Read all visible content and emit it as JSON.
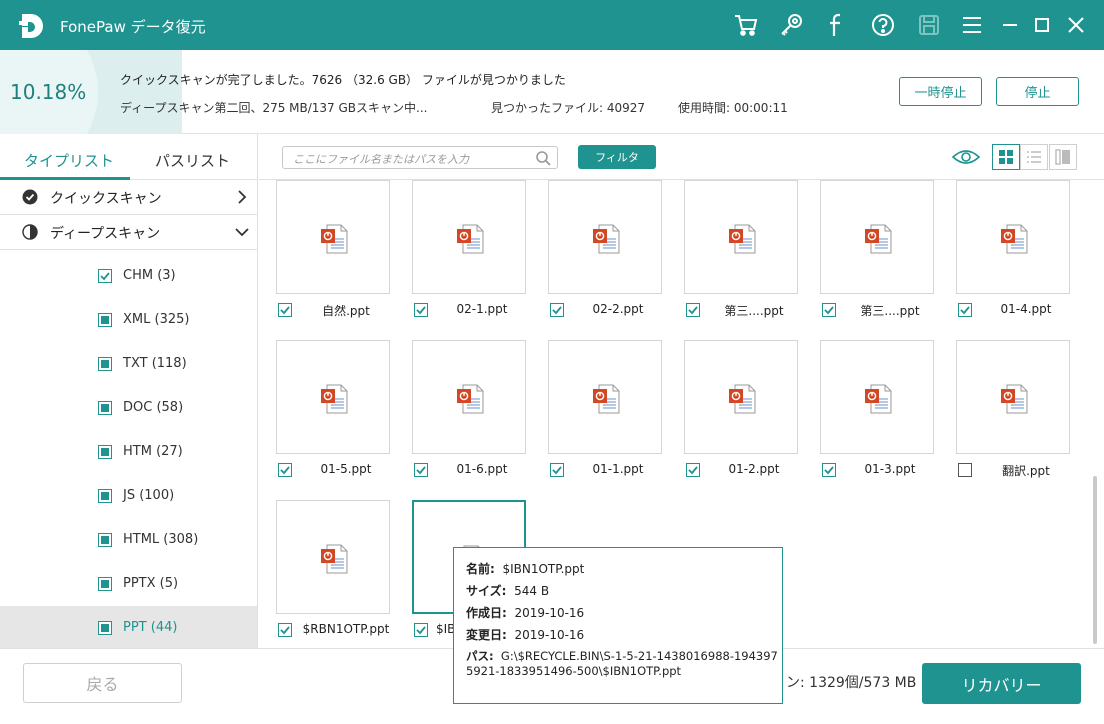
{
  "app": {
    "title": "FonePaw データ復元"
  },
  "status": {
    "percent": "10.18%",
    "line1": "クイックスキャンが完了しました。7626 （32.6 GB） ファイルが見つかりました",
    "line2": "ディープスキャン第二回、275 MB/137 GBスキャン中...",
    "found": "見つかったファイル: 40927",
    "elapsed": "使用時間: 00:00:11",
    "pause_label": "一時停止",
    "stop_label": "停止"
  },
  "sidebar": {
    "tabs": [
      "タイプリスト",
      "パスリスト"
    ],
    "quick_scan": "クイックスキャン",
    "deep_scan": "ディープスキャン",
    "types": [
      {
        "label": "CHM (3)",
        "state": "checked"
      },
      {
        "label": "XML (325)",
        "state": "partial"
      },
      {
        "label": "TXT (118)",
        "state": "partial"
      },
      {
        "label": "DOC (58)",
        "state": "partial"
      },
      {
        "label": "HTM (27)",
        "state": "partial"
      },
      {
        "label": "JS (100)",
        "state": "partial"
      },
      {
        "label": "HTML (308)",
        "state": "partial"
      },
      {
        "label": "PPTX (5)",
        "state": "partial"
      },
      {
        "label": "PPT (44)",
        "state": "partial"
      }
    ]
  },
  "toolbar": {
    "search_placeholder": "ここにファイル名またはパスを入力",
    "filter_label": "フィルタ"
  },
  "files": [
    {
      "name": "自然.ppt",
      "checked": true
    },
    {
      "name": "02-1.ppt",
      "checked": true
    },
    {
      "name": "02-2.ppt",
      "checked": true
    },
    {
      "name": "第三....ppt",
      "checked": true
    },
    {
      "name": "第三....ppt",
      "checked": true
    },
    {
      "name": "01-4.ppt",
      "checked": true
    },
    {
      "name": "01-5.ppt",
      "checked": true
    },
    {
      "name": "01-6.ppt",
      "checked": true
    },
    {
      "name": "01-1.ppt",
      "checked": true
    },
    {
      "name": "01-2.ppt",
      "checked": true
    },
    {
      "name": "01-3.ppt",
      "checked": true
    },
    {
      "name": "翻訳.ppt",
      "checked": false
    },
    {
      "name": "$RBN1OTP.ppt",
      "checked": true
    },
    {
      "name": "$IB",
      "checked": true
    }
  ],
  "tooltip": {
    "name_k": "名前:",
    "name_v": "$IBN1OTP.ppt",
    "size_k": "サイズ:",
    "size_v": "544 B",
    "created_k": "作成日:",
    "created_v": "2019-10-16",
    "modified_k": "変更日:",
    "modified_v": "2019-10-16",
    "path_k": "パス:",
    "path_v": "G:\\$RECYCLE.BIN\\S-1-5-21-1438016988-1943975921-1833951496-500\\$IBN1OTP.ppt"
  },
  "bottom": {
    "back_label": "戻る",
    "summary": "ン: 1329個/573 MB",
    "recover_label": "リカバリー"
  },
  "colors": {
    "accent": "#1f9390"
  }
}
